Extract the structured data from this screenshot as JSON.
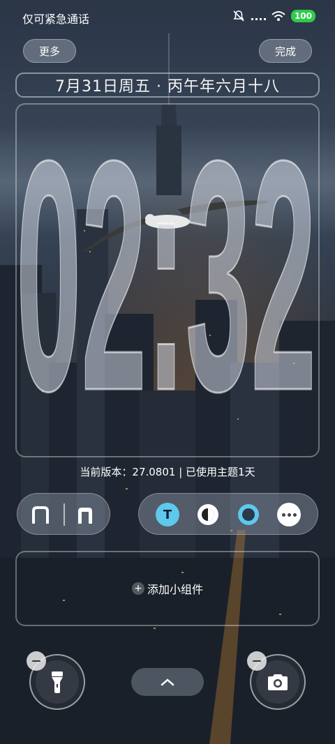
{
  "status_bar": {
    "carrier": "仅可紧急通话",
    "battery": "100",
    "icons": [
      "mute-icon",
      "signal-dots-icon",
      "wifi-icon",
      "battery-icon"
    ]
  },
  "top_buttons": {
    "more_label": "更多",
    "done_label": "完成"
  },
  "date_line": "7月31日周五 · 丙午年六月十八",
  "clock": {
    "time": "02:32"
  },
  "version_text": "当前版本：27.0801 | 已使用主题1天",
  "style_options": {
    "selected_letter": "T"
  },
  "widget": {
    "add_label": "添加小组件"
  },
  "colors": {
    "accent": "#5fc8ec",
    "battery": "#2fcb4a"
  }
}
